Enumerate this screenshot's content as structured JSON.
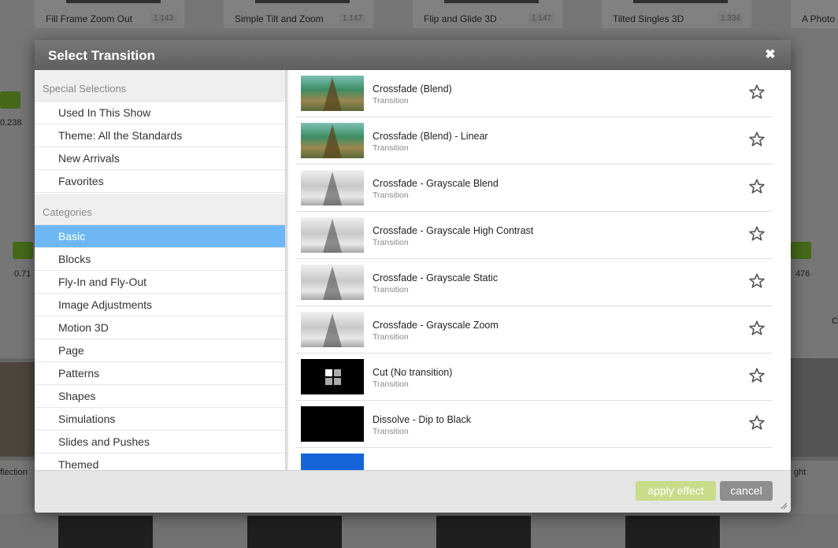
{
  "background": {
    "tiles": [
      {
        "name": "Fill Frame Zoom Out",
        "dur": "1.143"
      },
      {
        "name": "Simple Tilt and Zoom",
        "dur": "1.147"
      },
      {
        "name": "Flip and Glide 3D",
        "dur": "1.147"
      },
      {
        "name": "Tilted Singles 3D",
        "dur": "1.334"
      },
      {
        "name": "A Photo B",
        "dur": ""
      }
    ],
    "left_labels": [
      "0.238",
      "0.71",
      "flection"
    ],
    "right_labels": [
      "476",
      "ght",
      "C"
    ]
  },
  "modal": {
    "title": "Select Transition",
    "close_icon": "close-icon",
    "special_heading": "Special Selections",
    "special_items": [
      "Used In This Show",
      "Theme: All the Standards",
      "New Arrivals",
      "Favorites"
    ],
    "categories_heading": "Categories",
    "categories": [
      "Basic",
      "Blocks",
      "Fly-In and Fly-Out",
      "Image Adjustments",
      "Motion 3D",
      "Page",
      "Patterns",
      "Shapes",
      "Simulations",
      "Slides and Pushes",
      "Themed"
    ],
    "selected_category": "Basic",
    "transitions": [
      {
        "title": "Crossfade (Blend)",
        "type": "Transition",
        "thumb": "eiffel-color"
      },
      {
        "title": "Crossfade (Blend) - Linear",
        "type": "Transition",
        "thumb": "eiffel-color"
      },
      {
        "title": "Crossfade - Grayscale Blend",
        "type": "Transition",
        "thumb": "eiffel-gray"
      },
      {
        "title": "Crossfade - Grayscale High Contrast",
        "type": "Transition",
        "thumb": "eiffel-gray"
      },
      {
        "title": "Crossfade - Grayscale Static",
        "type": "Transition",
        "thumb": "eiffel-gray"
      },
      {
        "title": "Crossfade - Grayscale Zoom",
        "type": "Transition",
        "thumb": "eiffel-gray"
      },
      {
        "title": "Cut (No transition)",
        "type": "Transition",
        "thumb": "black-cut"
      },
      {
        "title": "Dissolve - Dip to Black",
        "type": "Transition",
        "thumb": "black"
      },
      {
        "title": "",
        "type": "",
        "thumb": "blue"
      }
    ],
    "apply_label": "apply effect",
    "cancel_label": "cancel",
    "colors": {
      "selected_row": "#6db8f4",
      "apply_disabled": "#c9dc8a",
      "cancel": "#8e8e8e",
      "header": "#666666"
    }
  }
}
